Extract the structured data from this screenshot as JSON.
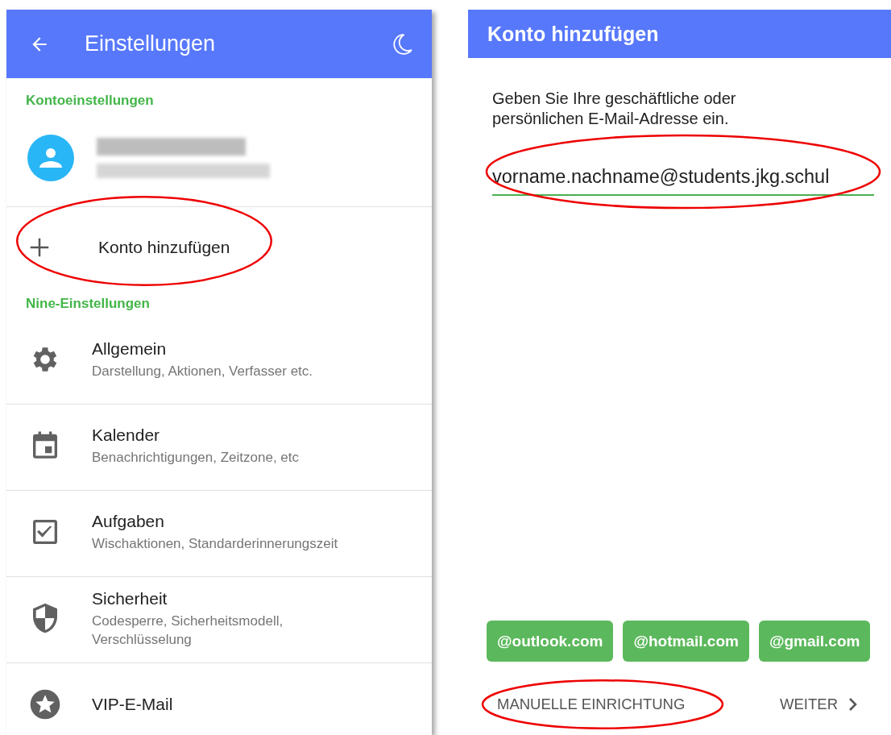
{
  "settings_screen": {
    "title": "Einstellungen",
    "account_section": {
      "heading": "Kontoeinstellungen"
    },
    "add_account": {
      "label": "Konto hinzufügen",
      "circled": true
    },
    "nine_section": {
      "heading": "Nine-Einstellungen"
    },
    "items": [
      {
        "kind": "gear",
        "title": "Allgemein",
        "subtitle": "Darstellung, Aktionen, Verfasser etc."
      },
      {
        "kind": "calendar",
        "title": "Kalender",
        "subtitle": "Benachrichtigungen, Zeitzone, etc"
      },
      {
        "kind": "checkbox",
        "title": "Aufgaben",
        "subtitle": "Wischaktionen, Standarderinnerungszeit"
      },
      {
        "kind": "shield",
        "title": "Sicherheit",
        "subtitle": "Codesperre, Sicherheitsmodell, Verschlüsselung"
      },
      {
        "kind": "star",
        "title": "VIP-E-Mail"
      }
    ]
  },
  "add_account_screen": {
    "title": "Konto hinzufügen",
    "instructions": "Geben Sie Ihre geschäftliche oder persönlichen E-Mail-Adresse ein.",
    "email_field": {
      "value": "vorname.nachname@students.jkg.schul",
      "circled": true
    },
    "domain_chips": [
      "@outlook.com",
      "@hotmail.com",
      "@gmail.com"
    ],
    "manual_setup": {
      "label": "MANUELLE EINRICHTUNG",
      "circled": true
    },
    "next": {
      "label": "WEITER"
    }
  }
}
